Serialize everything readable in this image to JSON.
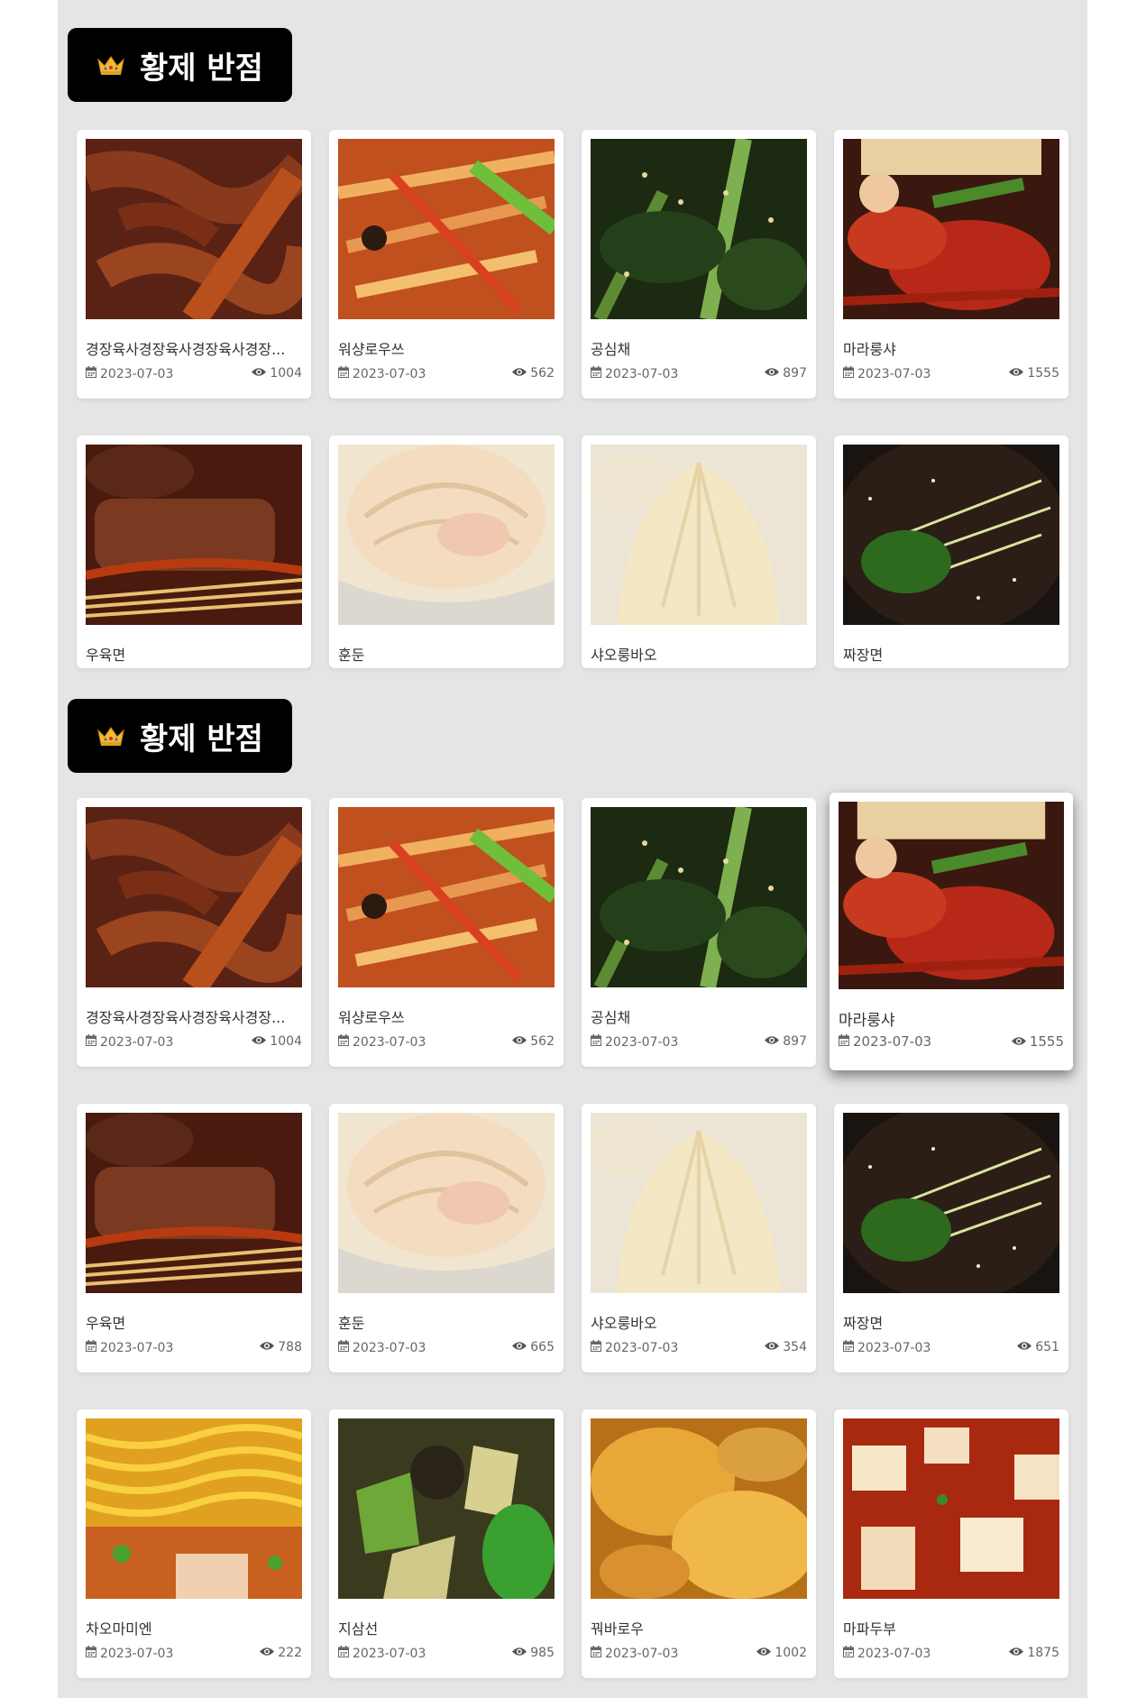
{
  "sections": [
    {
      "title": "황제 반점",
      "cards": [
        {
          "name": "경장육사경장육사경장육사경장...",
          "date": "2023-07-03",
          "views": "1004",
          "img": "pork-strips"
        },
        {
          "name": "워샹로우쓰",
          "date": "2023-07-03",
          "views": "562",
          "img": "yuxiang-pork"
        },
        {
          "name": "공심채",
          "date": "2023-07-03",
          "views": "897",
          "img": "water-spinach"
        },
        {
          "name": "마라룽샤",
          "date": "2023-07-03",
          "views": "1555",
          "img": "crayfish"
        },
        {
          "name": "우육면",
          "img": "beef-noodle"
        },
        {
          "name": "훈둔",
          "img": "wonton"
        },
        {
          "name": "샤오룽바오",
          "img": "xiaolongbao"
        },
        {
          "name": "짜장면",
          "img": "jajangmyeon"
        }
      ]
    },
    {
      "title": "황제 반점",
      "cards": [
        {
          "name": "경장육사경장육사경장육사경장...",
          "date": "2023-07-03",
          "views": "1004",
          "img": "pork-strips"
        },
        {
          "name": "워샹로우쓰",
          "date": "2023-07-03",
          "views": "562",
          "img": "yuxiang-pork"
        },
        {
          "name": "공심채",
          "date": "2023-07-03",
          "views": "897",
          "img": "water-spinach"
        },
        {
          "name": "마라룽샤",
          "date": "2023-07-03",
          "views": "1555",
          "img": "crayfish"
        },
        {
          "name": "우육면",
          "date": "2023-07-03",
          "views": "788",
          "img": "beef-noodle"
        },
        {
          "name": "훈둔",
          "date": "2023-07-03",
          "views": "665",
          "img": "wonton"
        },
        {
          "name": "샤오룽바오",
          "date": "2023-07-03",
          "views": "354",
          "img": "xiaolongbao"
        },
        {
          "name": "짜장면",
          "date": "2023-07-03",
          "views": "651",
          "img": "jajangmyeon"
        },
        {
          "name": "차오마미엔",
          "date": "2023-07-03",
          "views": "222",
          "img": "chaomamien"
        },
        {
          "name": "지삼선",
          "date": "2023-07-03",
          "views": "985",
          "img": "disanxian"
        },
        {
          "name": "꿔바로우",
          "date": "2023-07-03",
          "views": "1002",
          "img": "guobaorou"
        },
        {
          "name": "마파두부",
          "date": "2023-07-03",
          "views": "1875",
          "img": "mapo-tofu"
        }
      ]
    }
  ],
  "icons": {
    "crown": "crown-icon",
    "date": "calendar-icon",
    "views": "eye-icon"
  },
  "colors": {
    "header_bg": "#000000",
    "page_bg": "#e5e5e5",
    "card_bg": "#ffffff"
  }
}
